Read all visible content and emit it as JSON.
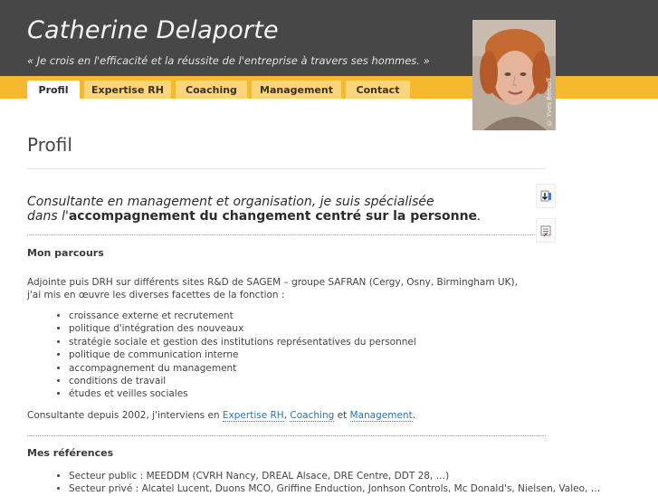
{
  "header": {
    "site_title": "Catherine Delaporte",
    "tagline": "« Je crois en l'efficacité et la réussite de l'entreprise à travers ses hommes. »"
  },
  "nav": {
    "tabs": [
      {
        "label": "Profil",
        "active": true
      },
      {
        "label": "Expertise RH",
        "active": false
      },
      {
        "label": "Coaching",
        "active": false
      },
      {
        "label": "Management",
        "active": false
      },
      {
        "label": "Contact",
        "active": false
      }
    ]
  },
  "portrait": {
    "credit": "© Yves Bercoff"
  },
  "colors": {
    "header_bg": "#474747",
    "nav_bar": "#f4b92c",
    "tab_bg": "#fbd57a",
    "link": "#2f73a8"
  },
  "main": {
    "title": "Profil",
    "intro": {
      "line1": "Consultante en management et organisation, je suis spécialisée",
      "line2_prefix": "dans l'",
      "line2_emphasis": "accompagnement du changement centré sur la personne",
      "line2_suffix": "."
    },
    "parcours": {
      "heading": "Mon parcours",
      "para1_line1": "Adjointe puis DRH sur différents sites R&D de SAGEM – groupe SAFRAN (Cergy, Osny, Birmingham UK),",
      "para1_line2": "j'ai mis en œuvre les diverses facettes de la fonction :",
      "items": [
        "croissance externe et recrutement",
        "politique d'intégration des nouveaux",
        "stratégie sociale et gestion des institutions représentatives du personnel",
        "politique de communication interne",
        "accompagnement du management",
        "conditions de travail",
        "études et veilles sociales"
      ],
      "closing_prefix": "Consultante depuis 2002, j'interviens en ",
      "link_expertise": "Expertise RH",
      "sep1": ", ",
      "link_coaching": "Coaching",
      "sep2": " et ",
      "link_management": "Management",
      "closing_suffix": "."
    },
    "references": {
      "heading": "Mes références",
      "items": [
        "Secteur public : MEEDDM (CVRH Nancy, DREAL Alsace, DRE Centre, DDT 28, …)",
        "Secteur privé : Alcatel Lucent, Duons MCO, Griffine Enduction, Jonhson Controls, Mc Donald's, Nielsen, Valeo, …"
      ]
    }
  },
  "sidebar_icons": [
    "download-icon",
    "print-icon"
  ]
}
